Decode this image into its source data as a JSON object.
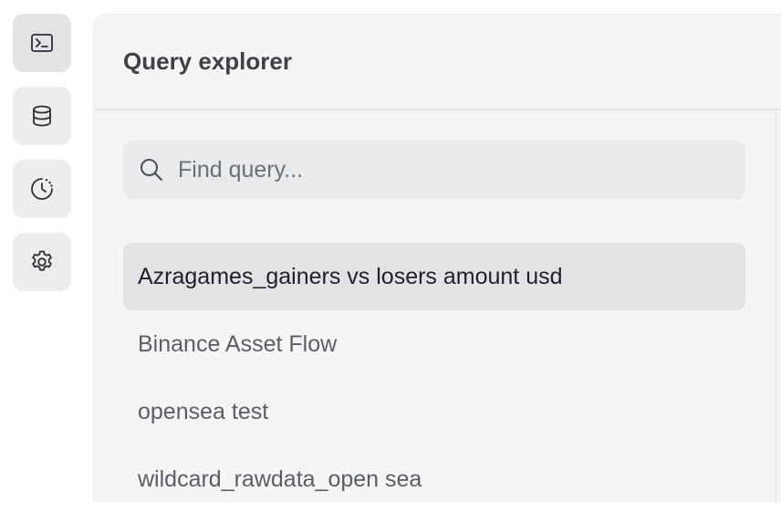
{
  "rail": {
    "items": [
      {
        "name": "terminal-icon",
        "active": true
      },
      {
        "name": "database-icon",
        "active": false
      },
      {
        "name": "history-icon",
        "active": false
      },
      {
        "name": "gear-icon",
        "active": false
      }
    ]
  },
  "panel": {
    "title": "Query explorer",
    "search": {
      "placeholder": "Find query...",
      "value": ""
    },
    "queries": [
      {
        "label": "Azragames_gainers vs losers amount usd",
        "selected": true
      },
      {
        "label": "Binance Asset Flow",
        "selected": false
      },
      {
        "label": "opensea test",
        "selected": false
      },
      {
        "label": "wildcard_rawdata_open sea",
        "selected": false
      }
    ]
  },
  "colors": {
    "panel_bg": "#f5f5f6",
    "rail_button_bg": "#eceded",
    "selected_bg": "#e2e3e5",
    "text_primary": "#202228",
    "text_secondary": "#5a5e65"
  }
}
